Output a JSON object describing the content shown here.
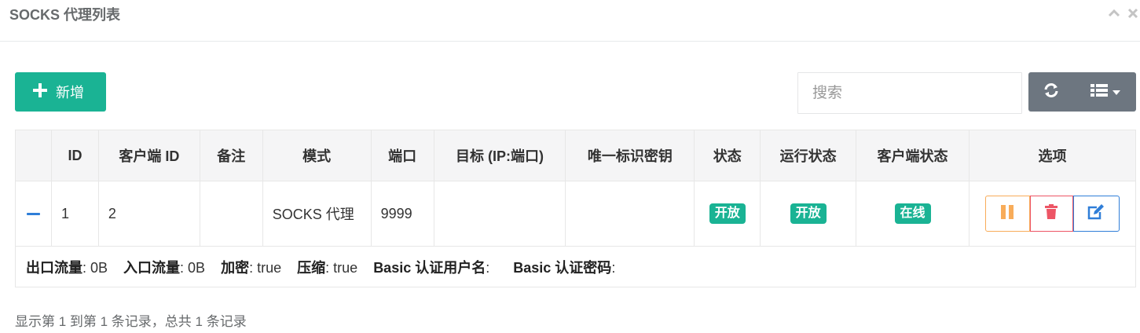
{
  "panel": {
    "title": "SOCKS 代理列表",
    "collapse_icon": "chevron-up-icon",
    "close_icon": "close-icon"
  },
  "toolbar": {
    "add_label": "新增",
    "search_placeholder": "搜索"
  },
  "table": {
    "headers": [
      "",
      "ID",
      "客户端 ID",
      "备注",
      "模式",
      "端口",
      "目标 (IP:端口)",
      "唯一标识密钥",
      "状态",
      "运行状态",
      "客户端状态",
      "选项"
    ],
    "rows": [
      {
        "id": "1",
        "client_id": "2",
        "remark": "",
        "mode": "SOCKS 代理",
        "port": "9999",
        "target": "",
        "key": "",
        "status": "开放",
        "run_status": "开放",
        "client_status": "在线",
        "detail": {
          "out_flow_label": "出口流量",
          "out_flow_value": ": 0B",
          "in_flow_label": "入口流量",
          "in_flow_value": ": 0B",
          "crypt_label": "加密",
          "crypt_value": ": true",
          "compress_label": "压缩",
          "compress_value": ": true",
          "basic_user_label": "Basic 认证用户名",
          "basic_user_value": ":",
          "basic_pass_label": "Basic 认证密码",
          "basic_pass_value": ":"
        }
      }
    ]
  },
  "footer": {
    "info": "显示第 1 到第 1 条记录，总共 1 条记录"
  },
  "colors": {
    "primary": "#1ab394",
    "warning": "#f8ac59",
    "danger": "#ed5565",
    "info": "#2f7ed8",
    "toolbar_gray": "#6d7680"
  }
}
